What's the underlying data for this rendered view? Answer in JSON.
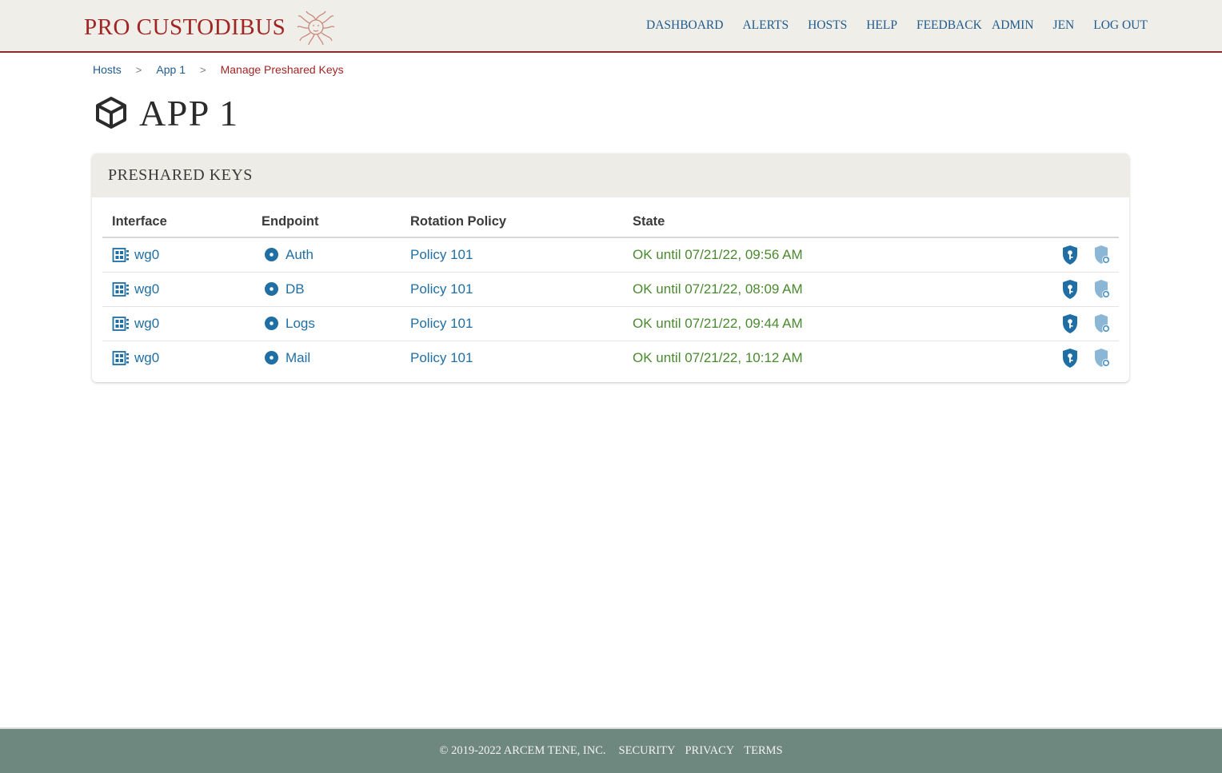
{
  "brand": {
    "name": "PRO CUSTODIBUS",
    "logo_icon": "medusa-logo-icon"
  },
  "nav": {
    "main": [
      "DASHBOARD",
      "ALERTS",
      "HOSTS",
      "HELP",
      "FEEDBACK"
    ],
    "user": [
      "ADMIN",
      "JEN",
      "LOG OUT"
    ]
  },
  "breadcrumb": {
    "items": [
      "Hosts",
      "App 1"
    ],
    "separator": ">",
    "current": "Manage Preshared Keys"
  },
  "page": {
    "title": "APP 1",
    "icon": "cube-icon"
  },
  "card": {
    "title": "PRESHARED KEYS",
    "columns": [
      "Interface",
      "Endpoint",
      "Rotation Policy",
      "State"
    ],
    "rows": [
      {
        "interface": "wg0",
        "endpoint": "Auth",
        "policy": "Policy 101",
        "state": "OK until 07/21/22, 09:56 AM"
      },
      {
        "interface": "wg0",
        "endpoint": "DB",
        "policy": "Policy 101",
        "state": "OK until 07/21/22, 08:09 AM"
      },
      {
        "interface": "wg0",
        "endpoint": "Logs",
        "policy": "Policy 101",
        "state": "OK until 07/21/22, 09:44 AM"
      },
      {
        "interface": "wg0",
        "endpoint": "Mail",
        "policy": "Policy 101",
        "state": "OK until 07/21/22, 10:12 AM"
      }
    ]
  },
  "footer": {
    "copyright": "© 2019-2022 ARCEM TENE, INC.",
    "links": [
      "SECURITY",
      "PRIVACY",
      "TERMS"
    ]
  },
  "colors": {
    "brand": "#a02524",
    "link": "#1f6fa5",
    "state_ok": "#4a8a2f",
    "header_bg": "#efeee8",
    "footer_bg": "#6e877f"
  }
}
